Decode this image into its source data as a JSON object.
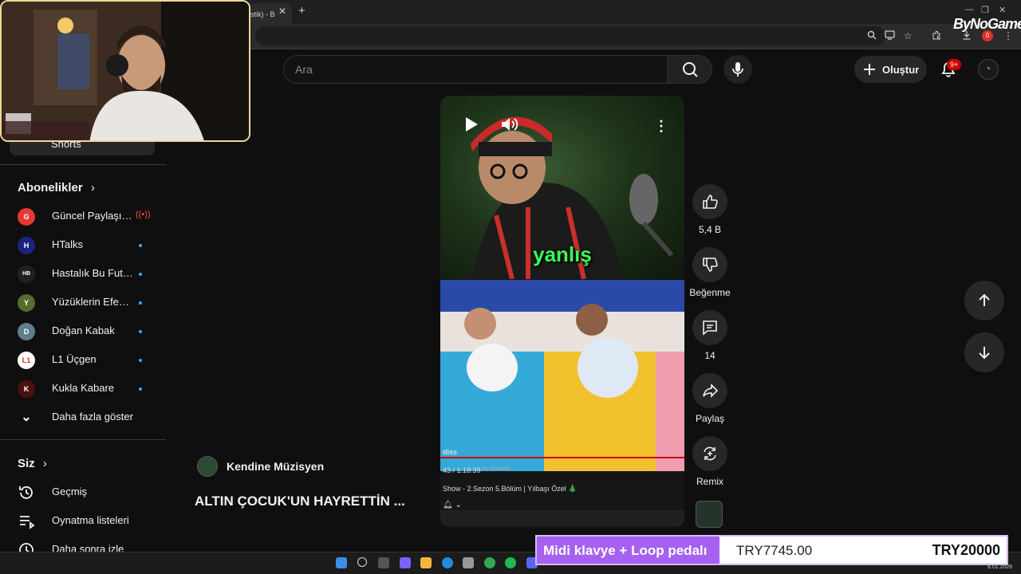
{
  "browser": {
    "tab_title": "stik) - B",
    "new_tab": "+",
    "tab_close": "✕",
    "profile_badge": "0",
    "brand_watermark": "ByNoGame"
  },
  "search": {
    "placeholder": "Ara"
  },
  "topbar": {
    "create_label": "Oluştur",
    "notif_badge": "9+"
  },
  "sidebar": {
    "shorts_label": "Shorts",
    "subscriptions_title": "Abonelikler",
    "subscriptions": [
      {
        "name": "Güncel Paylaşım...",
        "avatar_color": "#e53935",
        "avatar_text": "G",
        "status": "live"
      },
      {
        "name": "HTalks",
        "avatar_color": "#1a237e",
        "avatar_text": "H",
        "status": "new"
      },
      {
        "name": "Hastalık Bu Futbol",
        "avatar_color": "#212121",
        "avatar_text": "HB",
        "status": "new"
      },
      {
        "name": "Yüzüklerin Efend...",
        "avatar_color": "#556b2f",
        "avatar_text": "Y",
        "status": "new"
      },
      {
        "name": "Doğan Kabak",
        "avatar_color": "#607d8b",
        "avatar_text": "D",
        "status": "new"
      },
      {
        "name": "L1 Üçgen",
        "avatar_color": "#ffffff",
        "avatar_text": "L1",
        "status": "new"
      },
      {
        "name": "Kukla Kabare",
        "avatar_color": "#4a1010",
        "avatar_text": "K",
        "status": "new"
      }
    ],
    "show_more": "Daha fazla göster",
    "you_title": "Siz",
    "you_items": [
      {
        "label": "Geçmiş",
        "icon": "history-icon"
      },
      {
        "label": "Oynatma listeleri",
        "icon": "playlists-icon"
      },
      {
        "label": "Daha sonra izle",
        "icon": "watch-later-icon"
      }
    ]
  },
  "short": {
    "caption_word": "yanlış",
    "embedded_time": "43 / 1:18:39",
    "embedded_chip": "Bu videoda",
    "embedded_tag": "diss",
    "embedded_title": "Show - 2.Sezon 5.Bölüm | Yılbaşı Özel 🎄",
    "channel_name": "Kendine Müzisyen",
    "title": "ALTIN ÇOCUK'UN HAYRETTİN ..."
  },
  "actions": {
    "like_count": "5,4 B",
    "dislike_label": "Beğenme",
    "comment_count": "14",
    "share_label": "Paylaş",
    "remix_label": "Remix"
  },
  "donation": {
    "label": "Midi klavye + Loop pedalı",
    "current": "TRY7745.00",
    "goal": "TRY20000"
  },
  "taskbar": {
    "date": "8.01.2026"
  },
  "colors": {
    "accent_red": "#cc0000",
    "link_blue": "#3ea6ff",
    "caption_green": "#3aff5a",
    "donation_purple": "#a661f0",
    "webcam_border": "#f0d896"
  }
}
